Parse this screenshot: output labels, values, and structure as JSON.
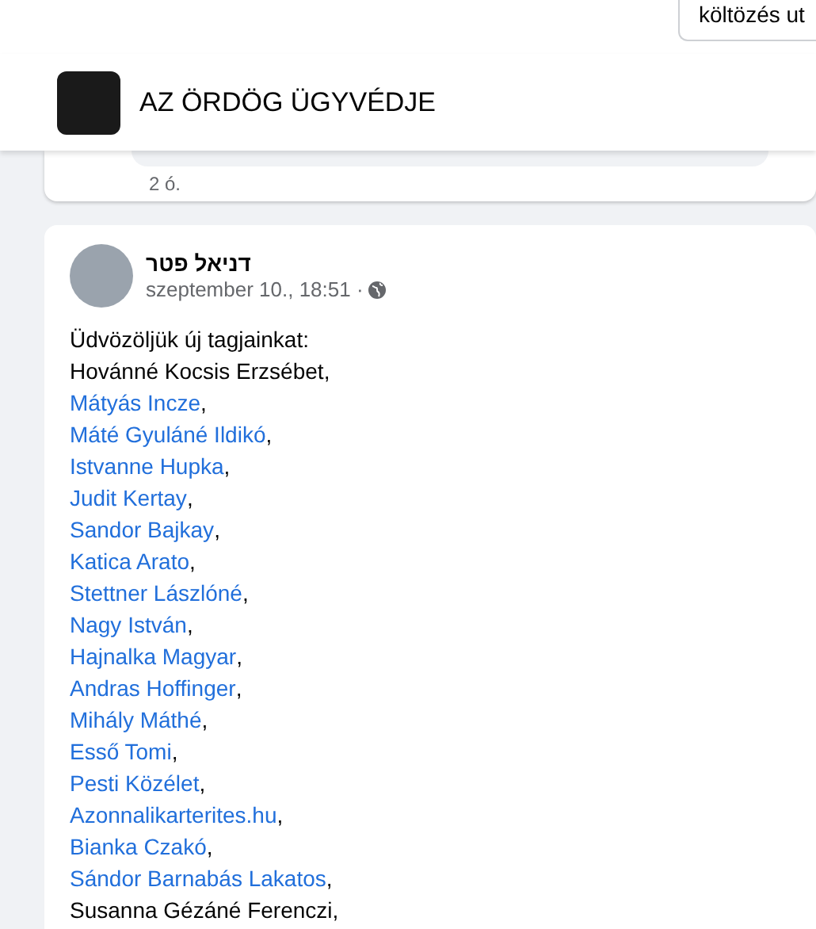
{
  "top_field": {
    "value": "költözés ut"
  },
  "group_header": {
    "title": "AZ ÖRDÖG ÜGYVÉDJE"
  },
  "previous_post": {
    "time": "2 ó."
  },
  "post": {
    "author": "דניאל פטר",
    "time": "szeptember 10., 18:51 ·",
    "intro": "Üdvözöljük új tagjainkat:",
    "members": [
      {
        "name": "Hovánné Kocsis Erzsébet",
        "link": false,
        "suffix": ","
      },
      {
        "name": "Mátyás Incze",
        "link": true,
        "suffix": ","
      },
      {
        "name": "Máté Gyuláné Ildikó",
        "link": true,
        "suffix": ","
      },
      {
        "name": "Istvanne Hupka",
        "link": true,
        "suffix": ","
      },
      {
        "name": "Judit Kertay",
        "link": true,
        "suffix": ","
      },
      {
        "name": "Sandor Bajkay",
        "link": true,
        "suffix": ","
      },
      {
        "name": "Katica Arato",
        "link": true,
        "suffix": ","
      },
      {
        "name": "Stettner Lászlóné",
        "link": true,
        "suffix": ","
      },
      {
        "name": "Nagy István",
        "link": true,
        "suffix": ","
      },
      {
        "name": "Hajnalka Magyar",
        "link": true,
        "suffix": ","
      },
      {
        "name": "Andras Hoffinger",
        "link": true,
        "suffix": ","
      },
      {
        "name": "Mihály Máthé",
        "link": true,
        "suffix": ","
      },
      {
        "name": "Esső Tomi",
        "link": true,
        "suffix": ","
      },
      {
        "name": "Pesti Közélet",
        "link": true,
        "suffix": ","
      },
      {
        "name": "Azonnalikarterites.hu",
        "link": true,
        "suffix": ","
      },
      {
        "name": "Bianka Czakó",
        "link": true,
        "suffix": ","
      },
      {
        "name": "Sándor Barnabás Lakatos",
        "link": true,
        "suffix": ","
      },
      {
        "name": "Susanna Gézáné Ferenczi",
        "link": false,
        "suffix": ","
      }
    ]
  }
}
